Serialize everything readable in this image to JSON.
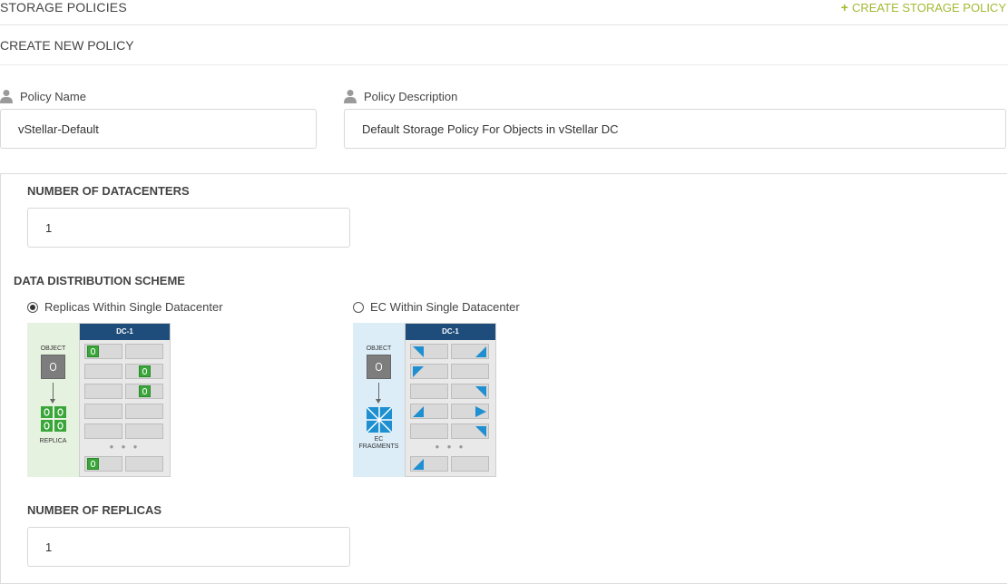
{
  "header": {
    "title": "STORAGE POLICIES",
    "create_action": "CREATE STORAGE POLICY",
    "create_icon": "plus-icon"
  },
  "subheader": {
    "title": "CREATE NEW POLICY"
  },
  "form": {
    "policy_name": {
      "label": "Policy Name",
      "value": "vStellar-Default",
      "icon": "person-icon"
    },
    "policy_description": {
      "label": "Policy Description",
      "value": "Default Storage Policy For Objects in vStellar DC",
      "icon": "person-icon"
    },
    "num_datacenters": {
      "label": "NUMBER OF DATACENTERS",
      "value": "1"
    },
    "distribution": {
      "label": "DATA DISTRIBUTION SCHEME",
      "options": [
        {
          "label": "Replicas Within Single Datacenter",
          "selected": true
        },
        {
          "label": "EC Within Single Datacenter",
          "selected": false
        }
      ]
    },
    "num_replicas": {
      "label": "NUMBER OF REPLICAS",
      "value": "1"
    }
  },
  "diagrams": {
    "replica": {
      "dc_label": "DC-1",
      "object_label": "OBJECT",
      "result_label": "REPLICA",
      "dots": "● ● ●",
      "bg_color": "#e6f2e0",
      "accent_color": "#3aa63a"
    },
    "ec": {
      "dc_label": "DC-1",
      "object_label": "OBJECT",
      "result_label_line1": "EC",
      "result_label_line2": "FRAGMENTS",
      "dots": "● ● ●",
      "bg_color": "#dcedf7",
      "accent_color": "#1e8fd0"
    }
  },
  "colors": {
    "accent": "#a5b832",
    "dc_header": "#1e4d7b",
    "text": "#444444",
    "border": "#d8d8d8"
  }
}
